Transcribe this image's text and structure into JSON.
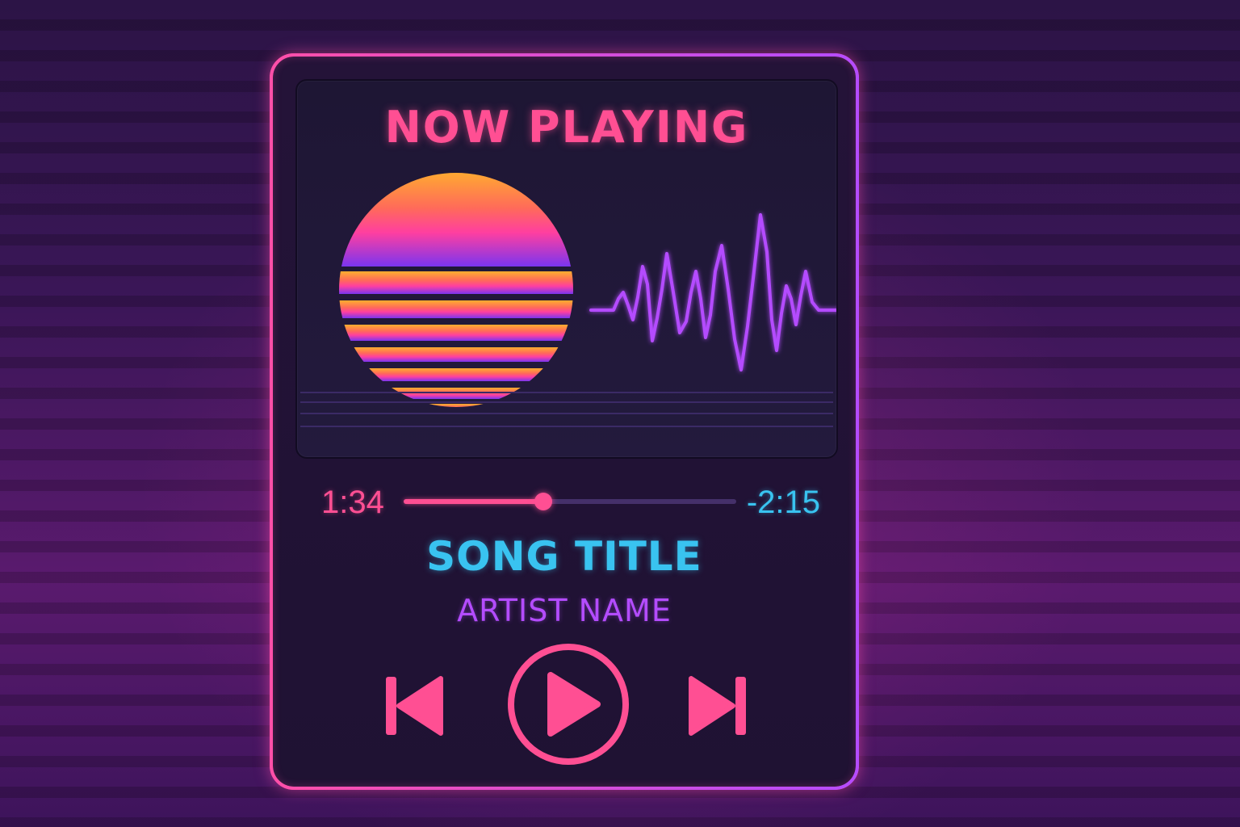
{
  "header": {
    "title": "NOW PLAYING"
  },
  "playback": {
    "elapsed": "1:34",
    "remaining": "-2:15",
    "progress": 0.42
  },
  "track": {
    "title": "SONG TITLE",
    "artist": "ARTIST NAME"
  },
  "controls": {
    "previous_icon": "skip-previous-icon",
    "play_icon": "play-icon",
    "next_icon": "skip-next-icon"
  },
  "colors": {
    "accent_pink": "#ff4f93",
    "accent_cyan": "#39c3f0",
    "accent_purple": "#b44cff",
    "sun_top": "#ffb02e",
    "sun_bottom": "#7a35f0"
  }
}
